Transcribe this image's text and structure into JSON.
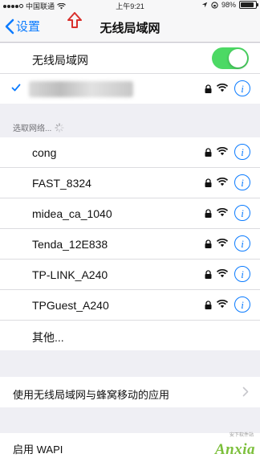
{
  "status_bar": {
    "carrier": "中国联通",
    "time": "上午9:21",
    "battery": "98%",
    "battery_level": 0.98
  },
  "nav": {
    "back_label": "设置",
    "title": "无线局域网"
  },
  "wifi_toggle": {
    "label": "无线局域网",
    "on": true
  },
  "section_header": "选取网络...",
  "networks": [
    {
      "name": "cong"
    },
    {
      "name": "FAST_8324"
    },
    {
      "name": "midea_ca_1040"
    },
    {
      "name": "Tenda_12E838"
    },
    {
      "name": "TP-LINK_A240"
    },
    {
      "name": "TPGuest_A240"
    }
  ],
  "other_label": "其他...",
  "apps_row_label": "使用无线局域网与蜂窝移动的应用",
  "wapi_label": "启用 WAPI",
  "watermark": {
    "brand": "Anxia",
    "sub": "安下软件站"
  },
  "colors": {
    "accent": "#0a7bff",
    "toggle_on": "#4cd964",
    "annotation": "#d9302c",
    "watermark": "#7bbf3a"
  },
  "icons": {
    "back": "chevron-left-icon",
    "lock": "lock-icon",
    "wifi": "wifi-icon",
    "info": "info-icon",
    "check": "checkmark-icon",
    "spinner": "spinner-icon",
    "disclosure": "chevron-right-icon"
  }
}
